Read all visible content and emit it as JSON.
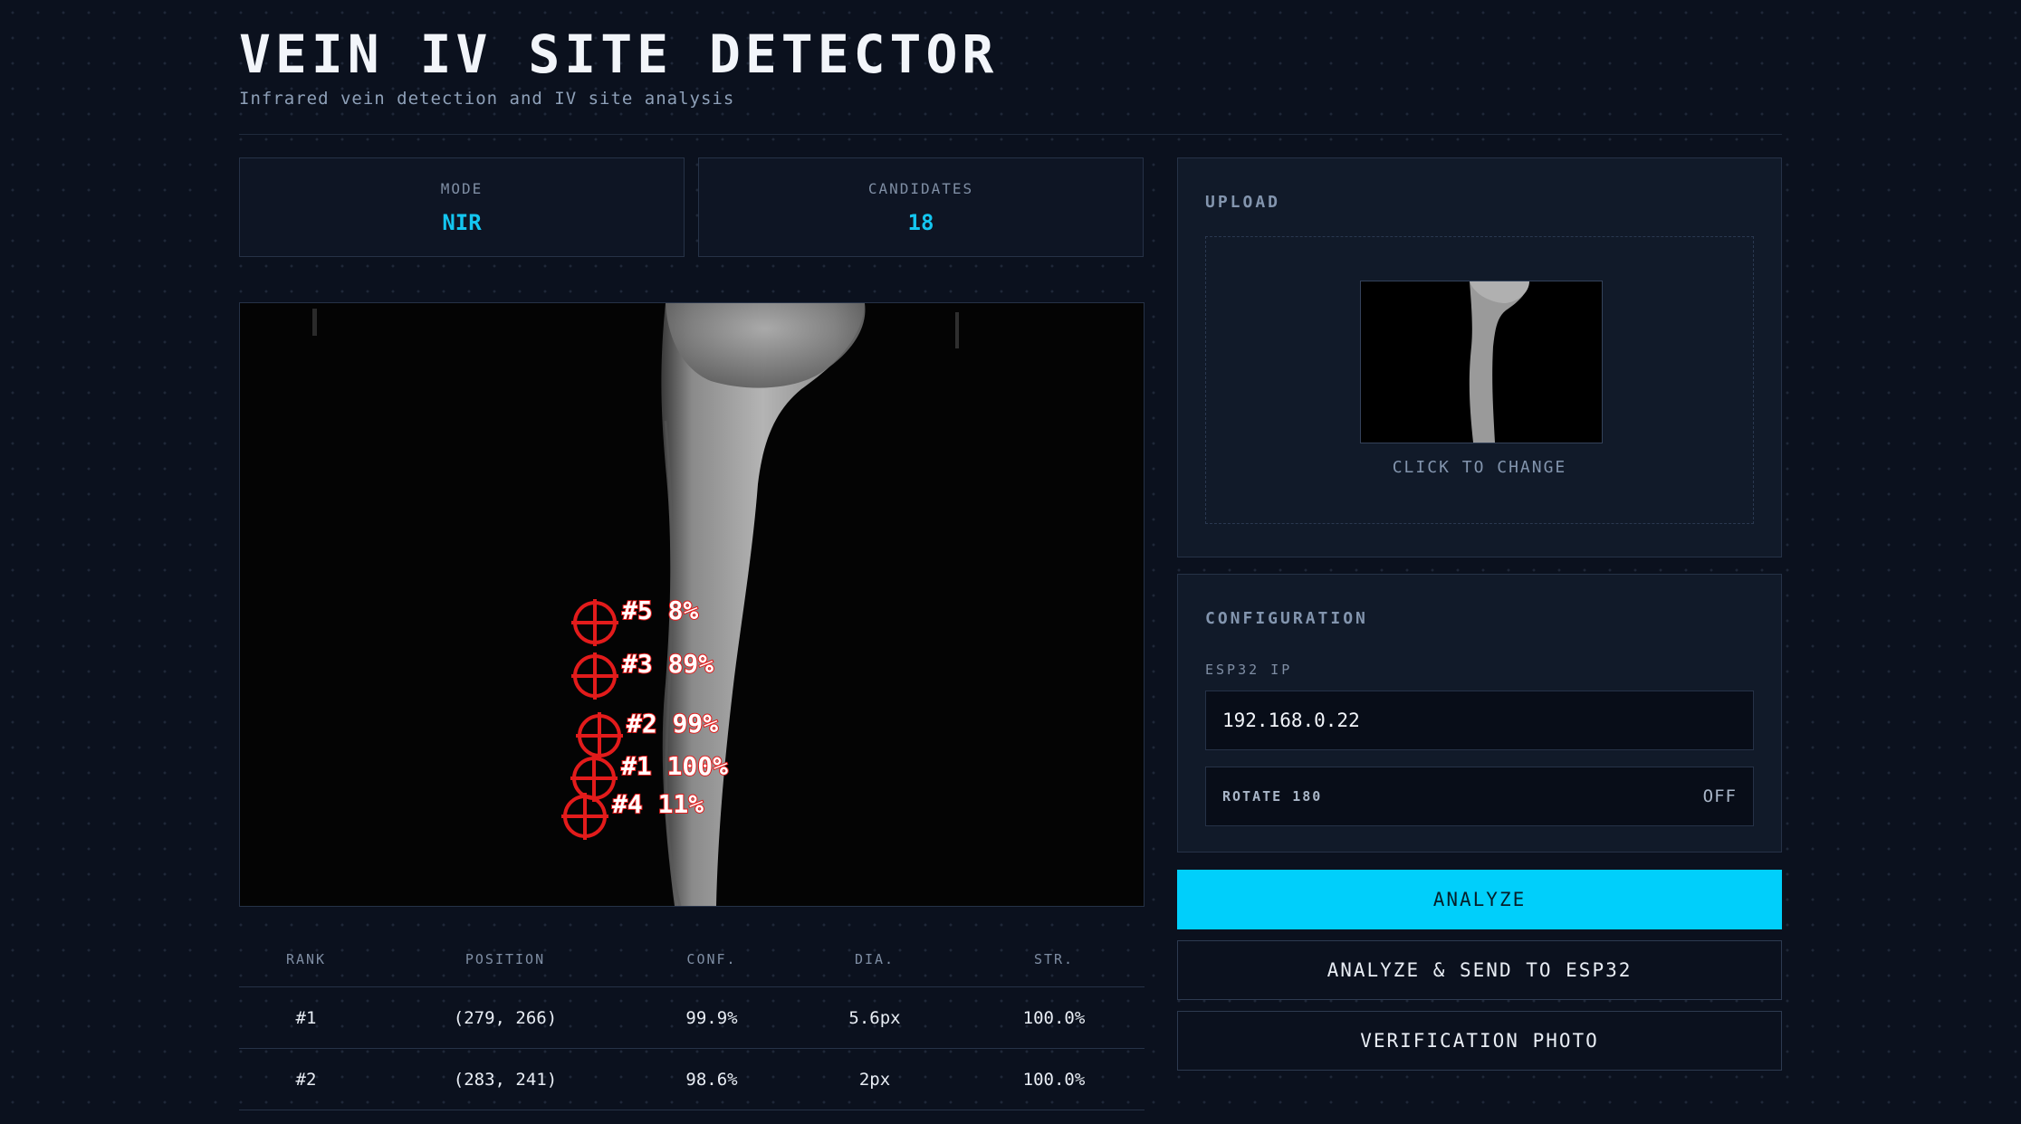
{
  "header": {
    "title": "VEIN IV SITE DETECTOR",
    "subtitle": "Infrared vein detection and IV site analysis"
  },
  "stats": {
    "mode_label": "MODE",
    "mode_value": "NIR",
    "candidates_label": "CANDIDATES",
    "candidates_value": "18"
  },
  "overlay": {
    "marker_color": "#e31b1b",
    "markers": [
      {
        "rank": "#5",
        "label": "#5  8%"
      },
      {
        "rank": "#3",
        "label": "#3  89%"
      },
      {
        "rank": "#2",
        "label": "#2  99%"
      },
      {
        "rank": "#1",
        "label": "#1  100%"
      },
      {
        "rank": "#4",
        "label": "#4  11%"
      }
    ]
  },
  "table": {
    "headers": [
      "RANK",
      "POSITION",
      "CONF.",
      "DIA.",
      "STR."
    ],
    "rows": [
      [
        "#1",
        "(279, 266)",
        "99.9%",
        "5.6px",
        "100.0%"
      ],
      [
        "#2",
        "(283, 241)",
        "98.6%",
        "2px",
        "100.0%"
      ]
    ]
  },
  "upload": {
    "title": "UPLOAD",
    "change_label": "CLICK TO CHANGE"
  },
  "config": {
    "title": "CONFIGURATION",
    "ip_label": "ESP32 IP",
    "ip_value": "192.168.0.22",
    "rotate_label": "ROTATE 180",
    "rotate_value": "OFF"
  },
  "actions": {
    "analyze": "ANALYZE",
    "analyze_send": "ANALYZE & SEND TO ESP32",
    "verification": "VERIFICATION PHOTO"
  },
  "colors": {
    "accent": "#00cffb",
    "background": "#0b111e",
    "marker": "#e31b1b"
  }
}
